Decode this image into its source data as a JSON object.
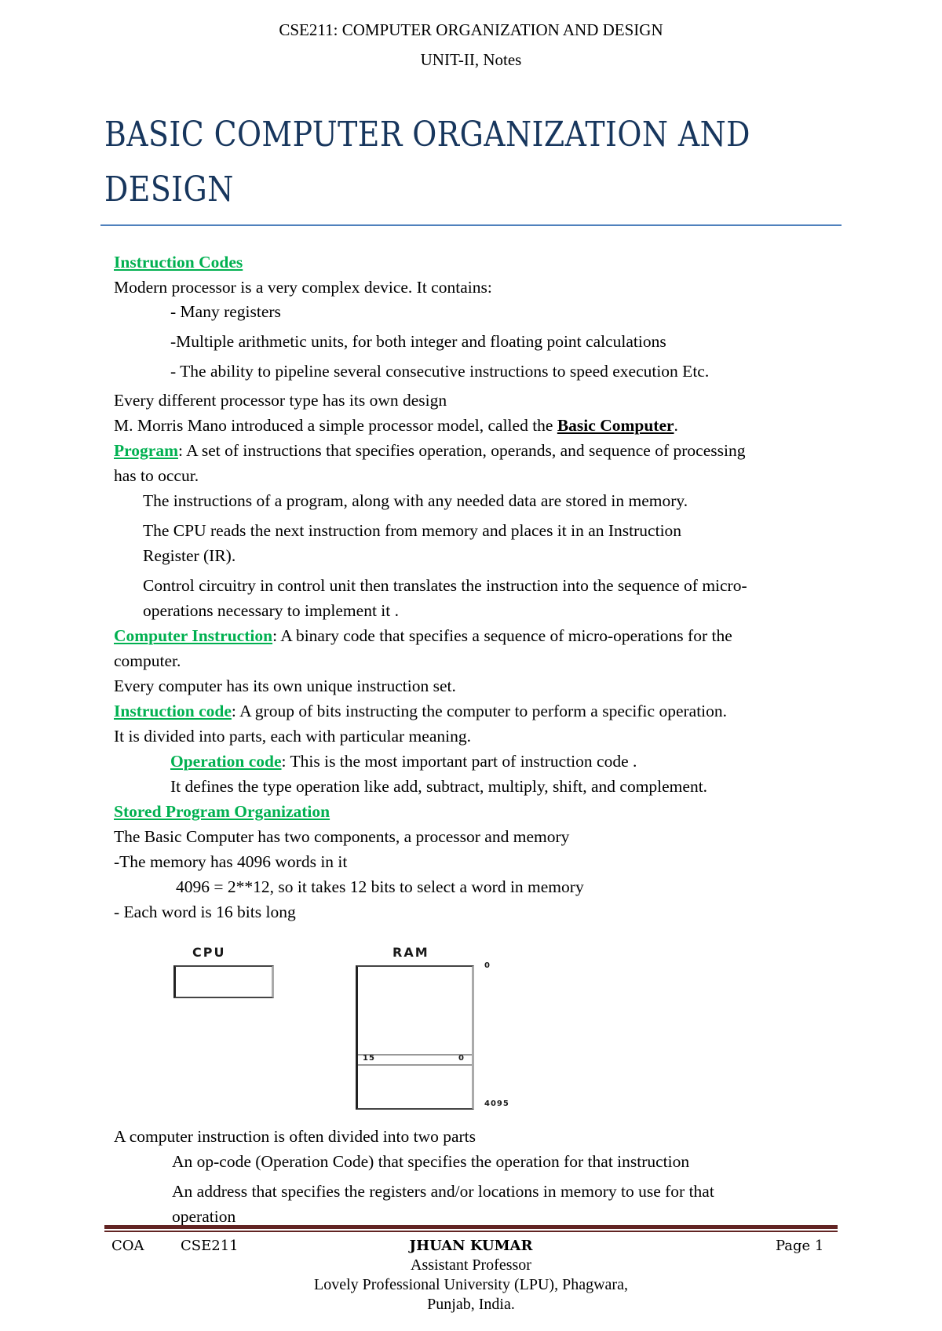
{
  "header": {
    "course_line": "CSE211: COMPUTER ORGANIZATION AND DESIGN",
    "unit_line": "UNIT-II, Notes"
  },
  "title": {
    "line1": "BASIC COMPUTER ORGANIZATION AND",
    "line2": "DESIGN"
  },
  "colors": {
    "title": "#17365d",
    "rule": "#4f81bd",
    "heading_green": "#00b050",
    "footer_rule": "#622423"
  },
  "body": {
    "instruction_codes_heading": "Instruction Codes",
    "intro": "Modern processor is a very complex device. It contains:",
    "bullets": [
      "- Many registers",
      "-Multiple arithmetic units, for both integer and floating point calculations",
      "- The ability to pipeline several consecutive instructions to speed execution  Etc."
    ],
    "own_design": "Every different processor type has its own design",
    "mano_prefix": "M. Morris Mano introduced a simple processor model, called the ",
    "mano_link": "Basic Computer",
    "mano_suffix": ".",
    "program_term": "Program",
    "program_def_line1": ": A set of instructions that specifies operation, operands, and sequence of processing",
    "program_def_line2": "has to occur.",
    "program_points": [
      "The instructions of a program, along with any needed data are stored in memory.",
      " The CPU reads the next instruction from memory and places it in an Instruction",
      "Register (IR).",
      "Control circuitry in control unit then translates the instruction into the sequence of micro-",
      "operations necessary to implement it ."
    ],
    "computer_instruction_term": "Computer Instruction",
    "computer_instruction_def_line1": ": A binary code that specifies a sequence of micro-operations for the",
    "computer_instruction_def_line2": "computer.",
    "unique_set": "Every computer has its own unique instruction set.",
    "instruction_code_term": "Instruction code",
    "instruction_code_def": ": A group of bits instructing the computer to perform a specific operation.",
    "divided_parts": " It is divided into parts, each with particular meaning.",
    "operation_code_term": "Operation code",
    "operation_code_def": ": This is the most important part of instruction code .",
    "operation_types": "It defines the type operation like add, subtract, multiply, shift, and complement.",
    "stored_program_heading": "Stored Program Organization",
    "two_components": "The Basic Computer has two components, a processor and memory",
    "memory_words": "-The memory has 4096 words in it",
    "memory_bits": "4096 = 2**12, so it takes 12 bits to select a word in memory",
    "word_length": "- Each  word is 16 bits long",
    "instruction_parts_intro": "A computer instruction is often divided into two parts",
    "instruction_parts": [
      "An op-code (Operation Code) that specifies the operation for that instruction",
      "An address that specifies the registers and/or locations in memory to use for that",
      "operation"
    ]
  },
  "diagram": {
    "cpu_label": "CPU",
    "ram_label": "RAM",
    "address_top": "0",
    "address_bottom": "4095",
    "word_msb": "15",
    "word_lsb": "0"
  },
  "footer": {
    "left1": "COA",
    "left2": "CSE211",
    "author": "JHUAN KUMAR",
    "designation": "Assistant Professor",
    "university": "Lovely Professional University (LPU), Phagwara,",
    "location": "Punjab, India.",
    "page": "Page 1"
  }
}
